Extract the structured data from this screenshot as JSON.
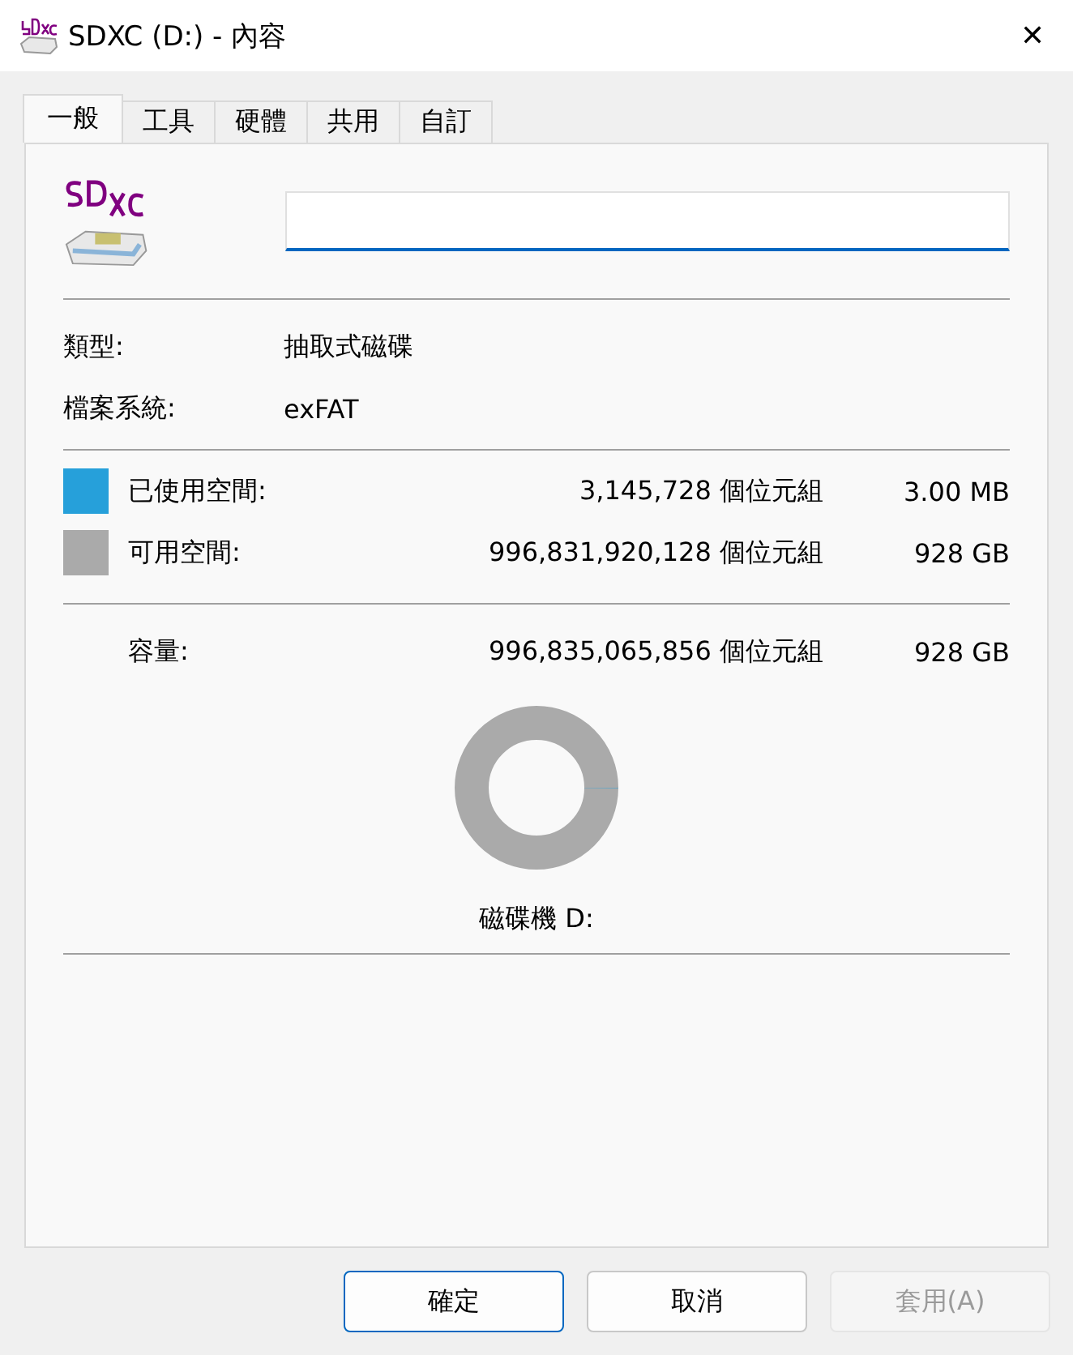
{
  "window": {
    "title": "SDXC (D:) - 內容",
    "close": "✕"
  },
  "tabs": [
    {
      "label": "一般",
      "selected": true
    },
    {
      "label": "工具",
      "selected": false
    },
    {
      "label": "硬體",
      "selected": false
    },
    {
      "label": "共用",
      "selected": false
    },
    {
      "label": "自訂",
      "selected": false
    }
  ],
  "info": [
    {
      "label": "類型:",
      "value": "抽取式磁碟"
    },
    {
      "label": "檔案系統:",
      "value": "exFAT"
    }
  ],
  "usage": [
    {
      "label": "已使用空間:",
      "bytes": "3,145,728 個位元組",
      "size": "3.00 MB",
      "color": "#26a0da"
    },
    {
      "label": "可用空間:",
      "bytes": "996,831,920,128 個位元組",
      "size": "928 GB",
      "color": "#aaaaaa"
    }
  ],
  "capacity": {
    "label": "容量:",
    "bytes": "996,835,065,856 個位元組",
    "size": "928 GB"
  },
  "drive_label": "磁碟機 D:",
  "buttons": [
    {
      "label": "確定",
      "kind": "default",
      "disabled": false
    },
    {
      "label": "取消",
      "kind": "normal",
      "disabled": false
    },
    {
      "label": "套用(A)",
      "kind": "normal",
      "disabled": true
    }
  ]
}
